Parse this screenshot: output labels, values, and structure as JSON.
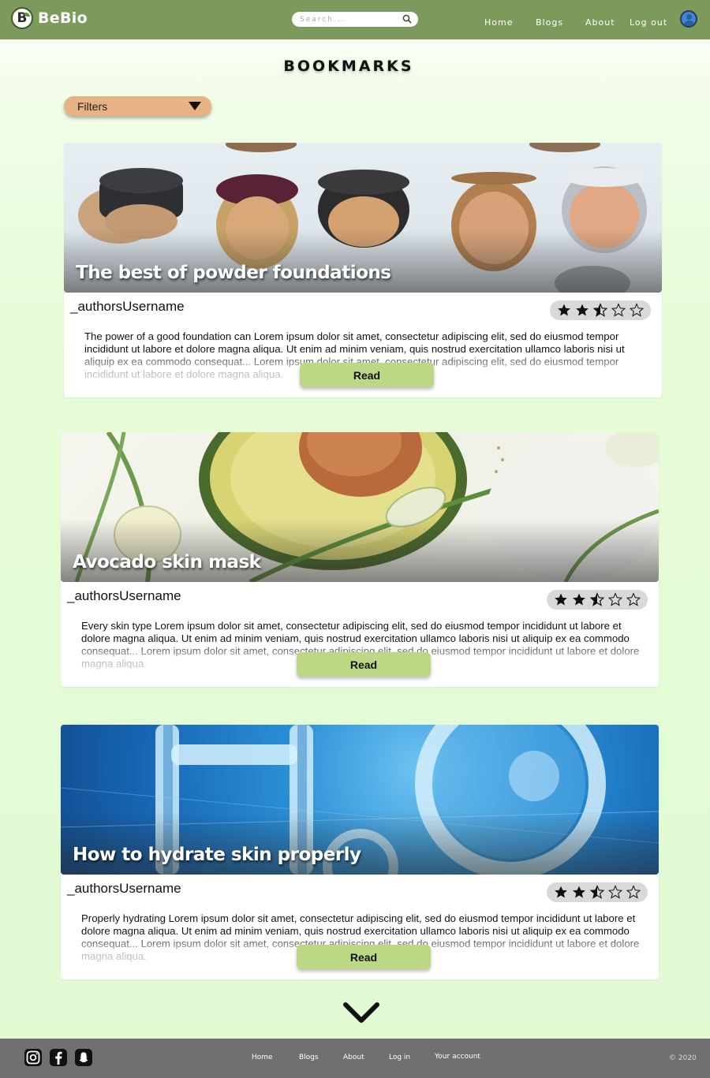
{
  "header": {
    "brand": "BeBio",
    "logo_letter": "B",
    "search_placeholder": "Search...",
    "nav": [
      "Home",
      "Blogs",
      "About",
      "Log out"
    ]
  },
  "page": {
    "title": "BOOKMARKS",
    "filters_label": "Filters"
  },
  "cards": [
    {
      "title": "The best of powder foundations",
      "author": "_authorsUsername",
      "rating": 2.5,
      "excerpt": "The power of a good foundation can Lorem ipsum dolor sit amet, consectetur adipiscing elit, sed do eiusmod tempor incididunt ut labore et dolore magna aliqua. Ut enim ad minim veniam, quis nostrud exercitation ullamco laboris nisi ut aliquip ex ea commodo consequat... Lorem ipsum dolor sit amet, consectetur adipiscing elit, sed do eiusmod tempor incididunt ut labore et dolore magna aliqua.",
      "read_label": "Read"
    },
    {
      "title": "Avocado skin mask",
      "author": "_authorsUsername",
      "rating": 2.5,
      "excerpt": "Every skin type Lorem ipsum dolor sit amet, consectetur adipiscing elit, sed do eiusmod tempor incididunt ut labore et dolore magna aliqua. Ut enim ad minim veniam, quis nostrud exercitation ullamco laboris nisi ut aliquip ex ea commodo consequat... Lorem ipsum dolor sit amet, consectetur adipiscing elit, sed do eiusmod tempor incididunt ut labore et dolore magna aliqua.",
      "read_label": "Read"
    },
    {
      "title": "How to hydrate skin properly",
      "author": "_authorsUsername",
      "rating": 2.5,
      "excerpt": "Properly hydrating Lorem ipsum dolor sit amet, consectetur adipiscing elit, sed do eiusmod tempor incididunt ut labore et dolore magna aliqua. Ut enim ad minim veniam, quis nostrud exercitation ullamco laboris nisi ut aliquip ex ea commodo consequat... Lorem ipsum dolor sit amet, consectetur adipiscing elit, sed do eiusmod tempor incididunt ut labore et dolore magna aliqua.",
      "read_label": "Read"
    }
  ],
  "footer": {
    "nav": [
      "Home",
      "Blogs",
      "About",
      "Log in",
      "Your account"
    ],
    "copyright": "© 2020",
    "social_icons": [
      "instagram-icon",
      "facebook-icon",
      "snapchat-icon"
    ]
  },
  "colors": {
    "header": "#7b9a5c",
    "filters": "#e8b384",
    "read_button": "#bcd884",
    "footer": "#707070",
    "rating_pill": "#d9d9d9"
  }
}
